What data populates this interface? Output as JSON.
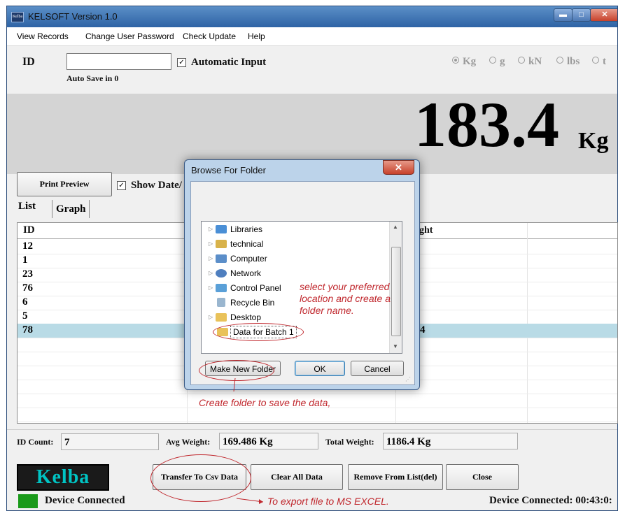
{
  "window": {
    "title": "KELSOFT Version 1.0",
    "icon_text": "Kelba",
    "minimize": "▬",
    "maximize": "□",
    "close": "✕"
  },
  "menu": [
    "View Records",
    "Change User Password",
    "Check Update",
    "Help"
  ],
  "top": {
    "id_label": "ID",
    "id_value": "",
    "auto_input_label": "Automatic Input",
    "auto_save": "Auto Save in 0",
    "units": [
      "Kg",
      "g",
      "kN",
      "lbs",
      "t"
    ],
    "selected_unit": "Kg"
  },
  "display": {
    "weight": "183.4",
    "unit": "Kg"
  },
  "controls": {
    "print_preview": "Print Preview",
    "show_date_label": "Show Date/"
  },
  "tabs": [
    "List",
    "Graph"
  ],
  "grid": {
    "headers": [
      "ID",
      "",
      "",
      "ght",
      ""
    ],
    "rows": [
      {
        "id": "12",
        "weight": ""
      },
      {
        "id": "1",
        "weight": ""
      },
      {
        "id": "23",
        "weight": ""
      },
      {
        "id": "76",
        "weight": ""
      },
      {
        "id": "6",
        "weight": ""
      },
      {
        "id": "5",
        "weight": ""
      },
      {
        "id": "78",
        "weight": "4",
        "selected": true
      }
    ]
  },
  "stats": {
    "id_count_label": "ID Count:",
    "id_count": "7",
    "avg_label": "Avg Weight:",
    "avg": "169.486 Kg",
    "total_label": "Total Weight:",
    "total": "1186.4 Kg"
  },
  "logo_text": "Kelba",
  "buttons": {
    "transfer": "Transfer To Csv Data",
    "clear": "Clear All Data",
    "remove": "Remove From List(del)",
    "close": "Close"
  },
  "status": {
    "device": "Device Connected",
    "timer": "Device Connected: 00:43:0:"
  },
  "dialog": {
    "title": "Browse For Folder",
    "close": "✕",
    "items": [
      {
        "label": "Libraries",
        "icon": "libraries-icon",
        "color": "#4a8fd6"
      },
      {
        "label": "technical",
        "icon": "user-folder-icon",
        "color": "#d8b24a"
      },
      {
        "label": "Computer",
        "icon": "computer-icon",
        "color": "#5b8ec9"
      },
      {
        "label": "Network",
        "icon": "network-icon",
        "color": "#4f7fbf"
      },
      {
        "label": "Control Panel",
        "icon": "control-panel-icon",
        "color": "#5aa0d8"
      },
      {
        "label": "Recycle Bin",
        "icon": "recycle-bin-icon",
        "color": "#9ab6cf"
      },
      {
        "label": "Desktop",
        "icon": "folder-icon",
        "color": "#e9c25a"
      },
      {
        "label": "Data for Batch 1",
        "icon": "folder-icon",
        "color": "#e9c25a"
      }
    ],
    "make_new_folder": "Make New Folder",
    "ok": "OK",
    "cancel": "Cancel"
  },
  "annotations": {
    "location": "select your preferred location and create a folder name.",
    "create_folder": "Create folder to save the data,",
    "export": "To export file to MS EXCEL."
  },
  "colors": {
    "accent_red": "#c0272d",
    "selected_row": "#b9dbe6",
    "logo_text": "#00c4c4",
    "led": "#1a9a1a"
  }
}
